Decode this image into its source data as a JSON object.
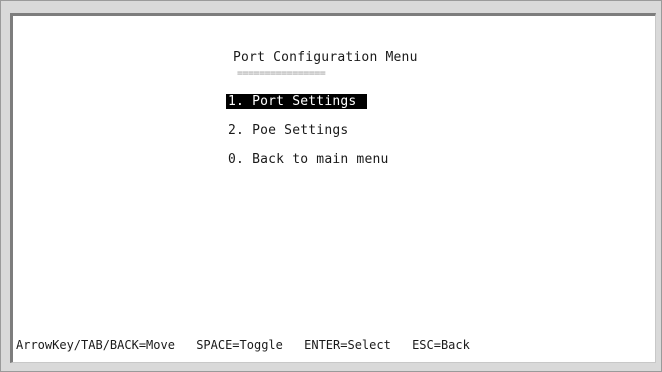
{
  "menu": {
    "title": "Port Configuration Menu",
    "underline": "================",
    "items": [
      {
        "label": "1. Port Settings",
        "selected": true
      },
      {
        "label": "2. Poe Settings",
        "selected": false
      },
      {
        "label": "0. Back to main menu",
        "selected": false
      }
    ]
  },
  "status_bar": {
    "items": [
      "ArrowKey/TAB/BACK=Move",
      "SPACE=Toggle",
      "ENTER=Select",
      "ESC=Back"
    ]
  }
}
